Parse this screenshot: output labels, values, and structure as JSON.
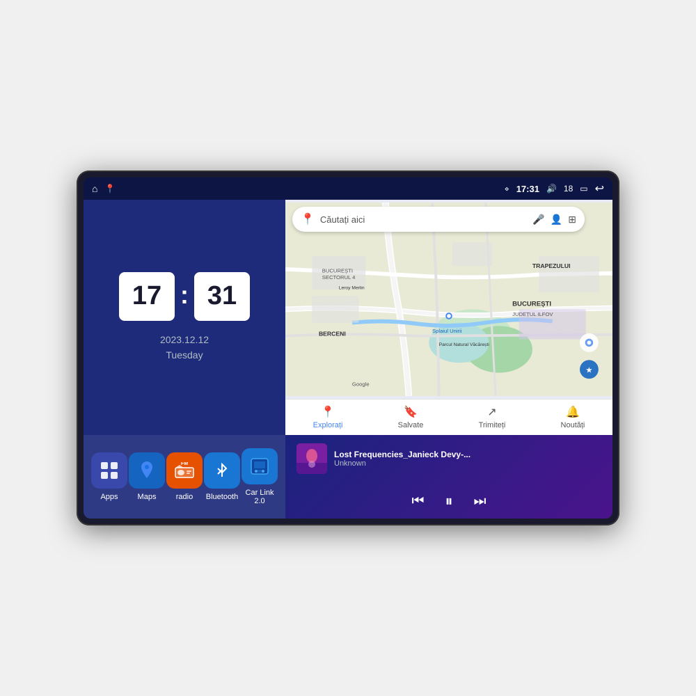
{
  "device": {
    "screen_bg": "#1a237e"
  },
  "status_bar": {
    "time": "17:31",
    "signal_bars": "18",
    "home_icon": "⌂",
    "nav_icon": "◁",
    "battery_icon": "▭",
    "volume_icon": "🔊",
    "location_icon": "⋄"
  },
  "clock": {
    "hour": "17",
    "minute": "31",
    "date_line1": "2023.12.12",
    "date_line2": "Tuesday"
  },
  "apps": [
    {
      "id": "apps",
      "label": "Apps",
      "icon": "⊞",
      "bg_class": "icon-apps"
    },
    {
      "id": "maps",
      "label": "Maps",
      "icon": "📍",
      "bg_class": "icon-maps"
    },
    {
      "id": "radio",
      "label": "radio",
      "icon": "📻",
      "bg_class": "icon-radio"
    },
    {
      "id": "bluetooth",
      "label": "Bluetooth",
      "icon": "🔷",
      "bg_class": "icon-bluetooth"
    },
    {
      "id": "carlink",
      "label": "Car Link 2.0",
      "icon": "📱",
      "bg_class": "icon-carlink"
    }
  ],
  "map": {
    "search_placeholder": "Căutați aici",
    "nav_items": [
      {
        "id": "explore",
        "label": "Explorați",
        "icon": "📍",
        "active": true
      },
      {
        "id": "saved",
        "label": "Salvate",
        "icon": "🔖",
        "active": false
      },
      {
        "id": "share",
        "label": "Trimiteți",
        "icon": "↗",
        "active": false
      },
      {
        "id": "news",
        "label": "Noutăți",
        "icon": "🔔",
        "active": false
      }
    ],
    "location_labels": [
      "BUCUREȘTI",
      "JUDEȚUL ILFOV",
      "TRAPEZULUI",
      "BERCENI",
      "Parcul Natural Văcărești",
      "Leroy Merlin",
      "BUCUREȘTI SECTORUL 4",
      "Splaiul Unirii",
      "Google"
    ]
  },
  "music": {
    "title": "Lost Frequencies_Janieck Devy-...",
    "artist": "Unknown",
    "prev_label": "⏮",
    "play_label": "⏸",
    "next_label": "⏭"
  }
}
